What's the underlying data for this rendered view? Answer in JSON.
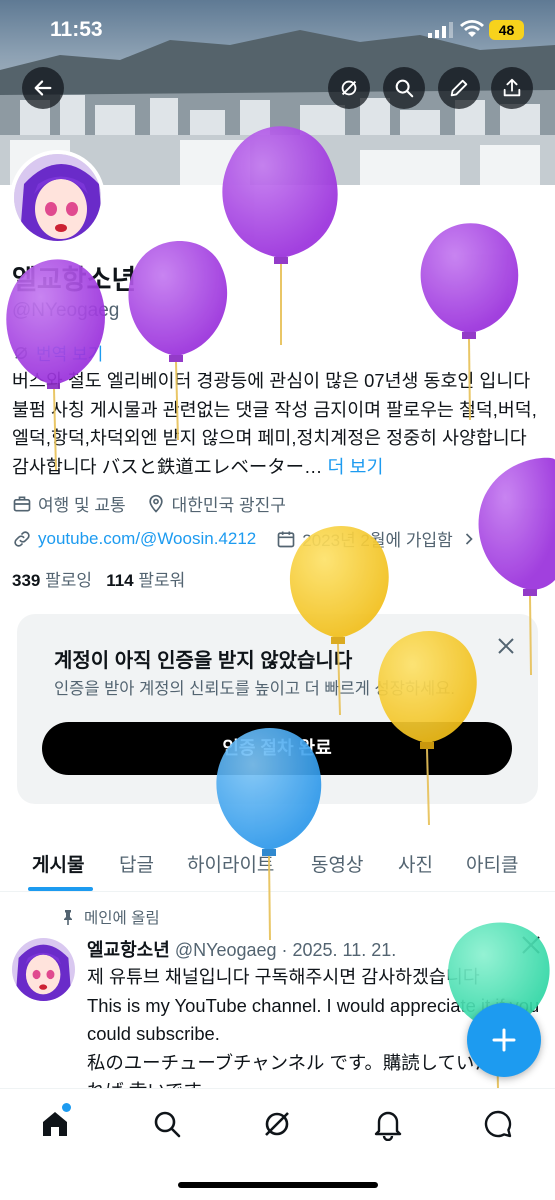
{
  "status": {
    "time": "11:53",
    "battery": "48"
  },
  "profile": {
    "name": "엘교항소년",
    "handle": "@NYeogaeg",
    "translate": "번역 보기",
    "bio": "버스와 철도 엘리베이터 경광등에 관심이 많은 07년생 동호인 입니다 불펌 사칭 게시물과 관련없는 댓글 작성 금지이며 팔로우는 철덕,버덕,엘덕,항덕,차덕외엔 받지 않으며 페미,정치계정은 정중히 사양합니다 감사합니다 バスと鉄道エレベーター…",
    "bio_more": "더 보기",
    "category": "여행 및 교통",
    "location": "대한민국 광진구",
    "link": "youtube.com/@Woosin.4212",
    "joined": "2023년 2월에 가입함",
    "following_count": "339",
    "following_label": "팔로잉",
    "followers_count": "114",
    "followers_label": "팔로워"
  },
  "verify_card": {
    "title": "계정이 아직 인증을 받지 않았습니다",
    "subtitle": "인증을 받아 계정의 신뢰도를 높이고 더 빠르게 성장하세요.",
    "button": "인증 절차 완료"
  },
  "tabs": [
    "게시물",
    "답글",
    "하이라이트",
    "동영상",
    "사진",
    "아티클"
  ],
  "post": {
    "pinned_label": "메인에 올림",
    "author": "엘교항소년",
    "handle_date": "@NYeogaeg · 2025. 11. 21.",
    "lines": [
      "제 유튜브 채널입니다 구독해주시면 감사하겠습니다",
      "This is my YouTube channel. I would appreciate it if you could subscribe.",
      "私のユーチューブチャンネル です。購読していただければ 幸いです。"
    ]
  },
  "colors": {
    "accent": "#1d9bf0",
    "balloon_purple": "#a13ee0",
    "balloon_yellow": "#f7cb2a",
    "balloon_blue": "#3aa6f0",
    "balloon_green": "#3fe0b0"
  }
}
